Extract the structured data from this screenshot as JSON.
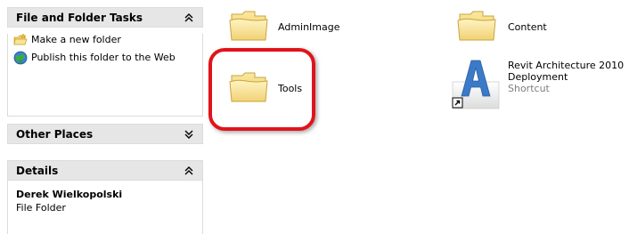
{
  "task_pane": {
    "file_folder_tasks": {
      "title": "File and Folder Tasks",
      "tasks": [
        {
          "label": "Make a new folder",
          "icon": "new-folder-icon"
        },
        {
          "label": "Publish this folder to the Web",
          "icon": "globe-publish-icon"
        }
      ]
    },
    "other_places": {
      "title": "Other Places"
    },
    "details": {
      "title": "Details",
      "name": "Derek Wielkopolski",
      "type": "File Folder"
    }
  },
  "items": {
    "admin_image": {
      "label": "AdminImage",
      "icon": "folder-icon"
    },
    "content": {
      "label": "Content",
      "icon": "folder-icon"
    },
    "tools": {
      "label": "Tools",
      "icon": "folder-icon"
    },
    "revit": {
      "label_line1": "Revit Architecture 2010",
      "label_line2": "Deployment",
      "label_line3": "Shortcut",
      "icon": "revit-shortcut-icon"
    }
  },
  "colors": {
    "highlight_ring": "#e0141b",
    "panel_header": "#e6e6e6",
    "revit_blue": "#3a7ac8"
  }
}
